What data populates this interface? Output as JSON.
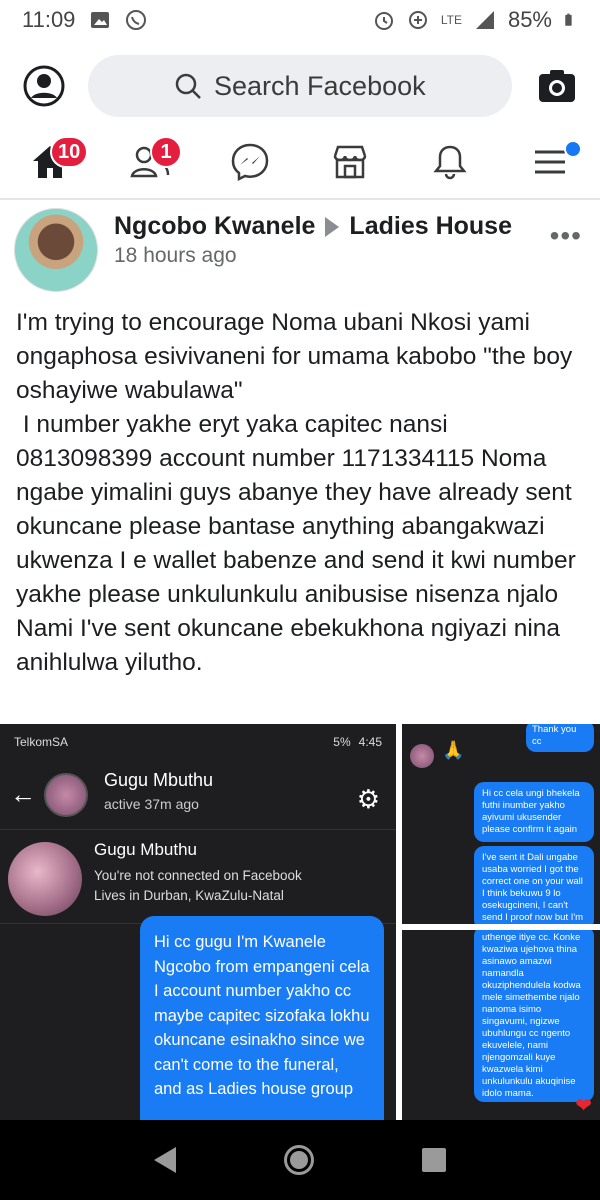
{
  "status_bar": {
    "time": "11:09",
    "battery": "85%",
    "network": "LTE"
  },
  "header": {
    "search_placeholder": "Search Facebook"
  },
  "nav": {
    "home_badge": "10",
    "friends_badge": "1"
  },
  "post": {
    "author": "Ngcobo Kwanele",
    "group": "Ladies House",
    "time": "18 hours ago",
    "text": "I'm trying to encourage Noma ubani Nkosi yami ongaphosa esivivaneni for umama kabobo \"the boy oshayiwe wabulawa\"\n I number yakhe eryt yaka capitec nansi 0813098399 account number 1171334115 Noma ngabe yimalini guys abanye they have already sent okuncane please bantase anything abangakwazi ukwenza I e wallet babenze and send it kwi number yakhe please unkulunkulu anibusise nisenza njalo Nami I've sent okuncane ebekukhona ngiyazi nina anihlulwa yilutho."
  },
  "screenshot_main": {
    "carrier": "TelkomSA",
    "battery": "5%",
    "time": "4:45",
    "contact_name": "Gugu Mbuthu",
    "active": "active 37m ago",
    "profile_name": "Gugu Mbuthu",
    "profile_line1": "You're not connected on Facebook",
    "profile_line2": "Lives in Durban, KwaZulu-Natal",
    "message": "Hi cc gugu I'm Kwanele Ngcobo from empangeni cela I account number yakho cc maybe capitec sizofaka lokhu okuncane esinakho since we can't come to the funeral, and as Ladies house group"
  },
  "screenshot_top_right": {
    "top_bubble": "Thank you cc",
    "bubble1": "Hi cc cela ungi bhekela futhi inumber yakho ayivumi ukusender please confirm it again",
    "bubble2": "I've sent it Dali ungabe usaba worried I got the correct one on your wall I think bekuwu 9 lo osekugcineni, I can't send I proof now but I'm sure"
  },
  "screenshot_bot_right": {
    "bubble": "uthenge itiye cc. Konke kwaziwa ujehova thina asinawo amazwi namandla okuziphendulela kodwa mele simethembe njalo nanoma isimo singavumi, ngizwe ubuhlungu cc ngento ekuvelele, nami njengomzali kuye kwazwela kimi unkulunkulu akuqinise idolo mama."
  }
}
